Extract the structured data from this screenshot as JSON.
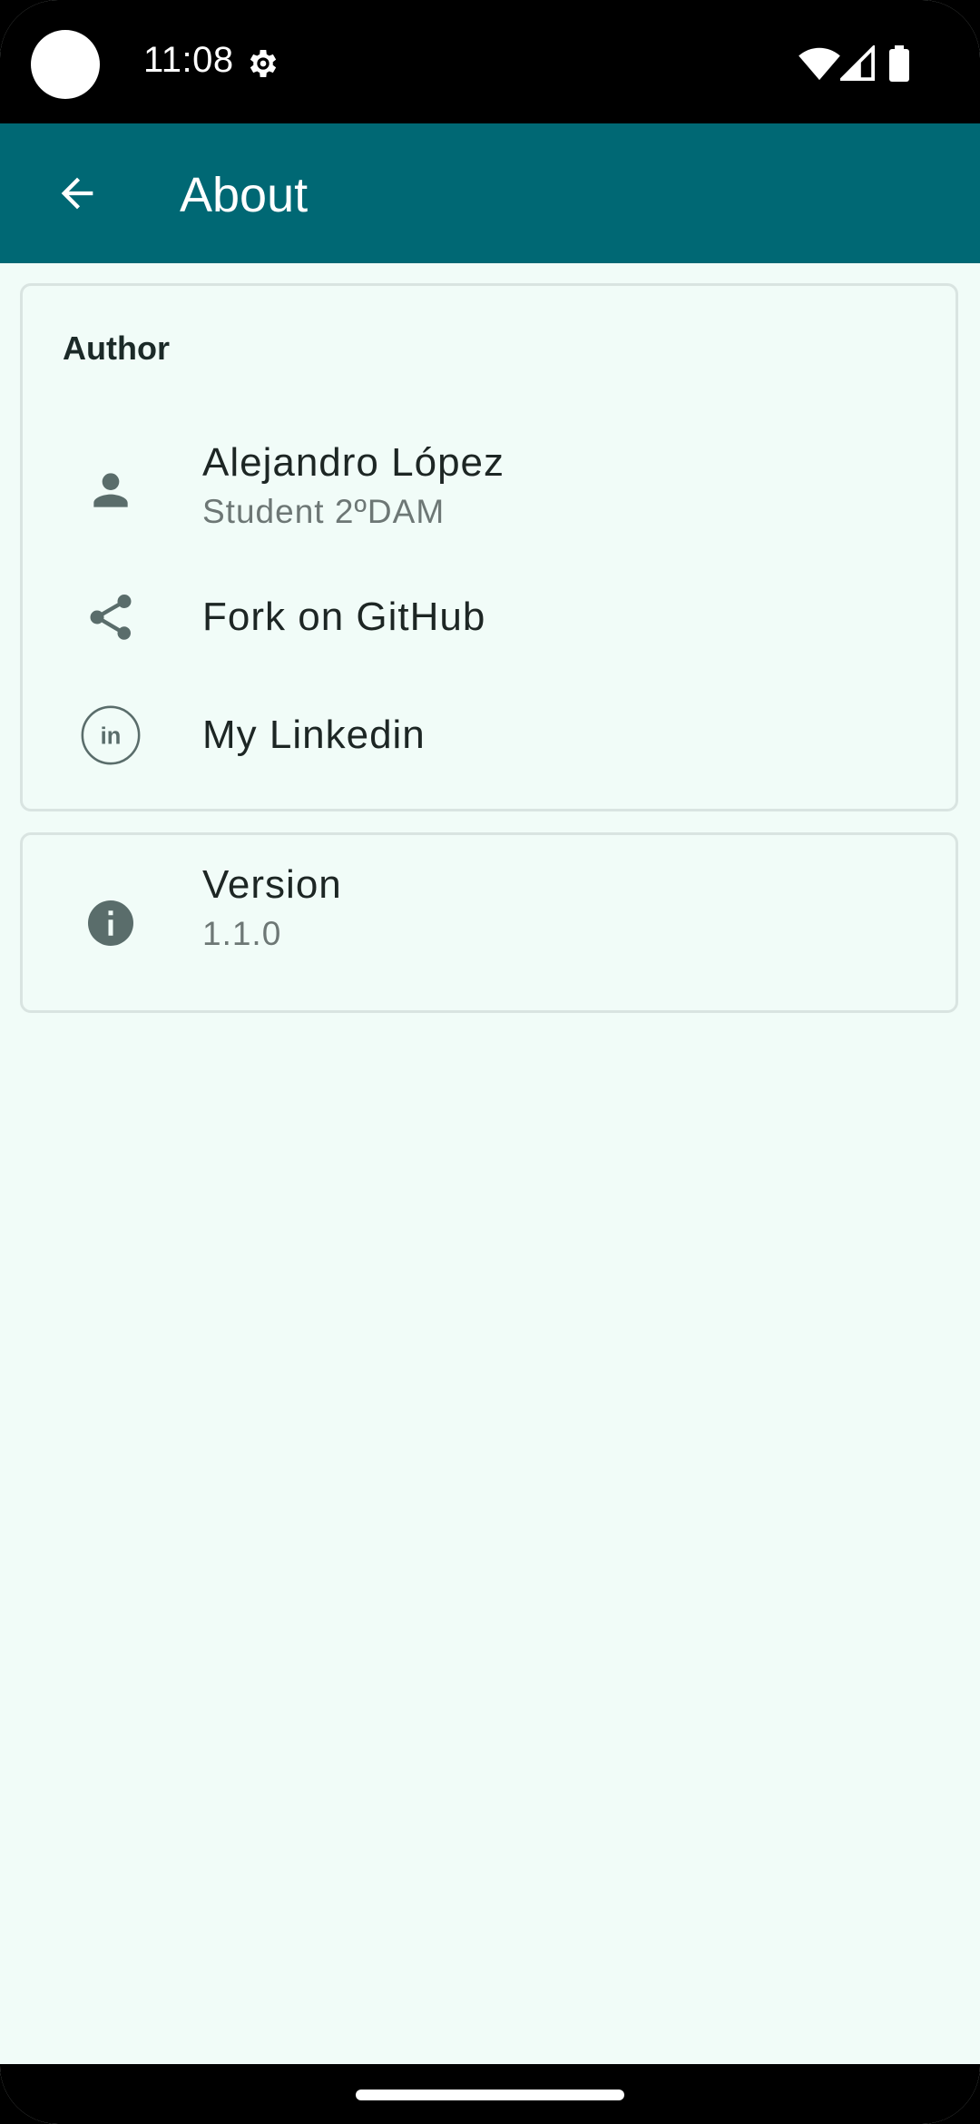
{
  "status_bar": {
    "time": "11:08"
  },
  "app_bar": {
    "title": "About"
  },
  "author_section": {
    "title": "Author",
    "items": [
      {
        "icon": "person-icon",
        "primary": "Alejandro López",
        "secondary": "Student 2ºDAM"
      },
      {
        "icon": "share-icon",
        "primary": "Fork on GitHub"
      },
      {
        "icon": "linkedin-icon",
        "primary": "My Linkedin"
      }
    ]
  },
  "version_section": {
    "icon": "info-icon",
    "primary": "Version",
    "secondary": "1.1.0"
  },
  "colors": {
    "app_bar": "#006874",
    "background": "#f1fcf8",
    "icon": "#5a6d6b"
  }
}
